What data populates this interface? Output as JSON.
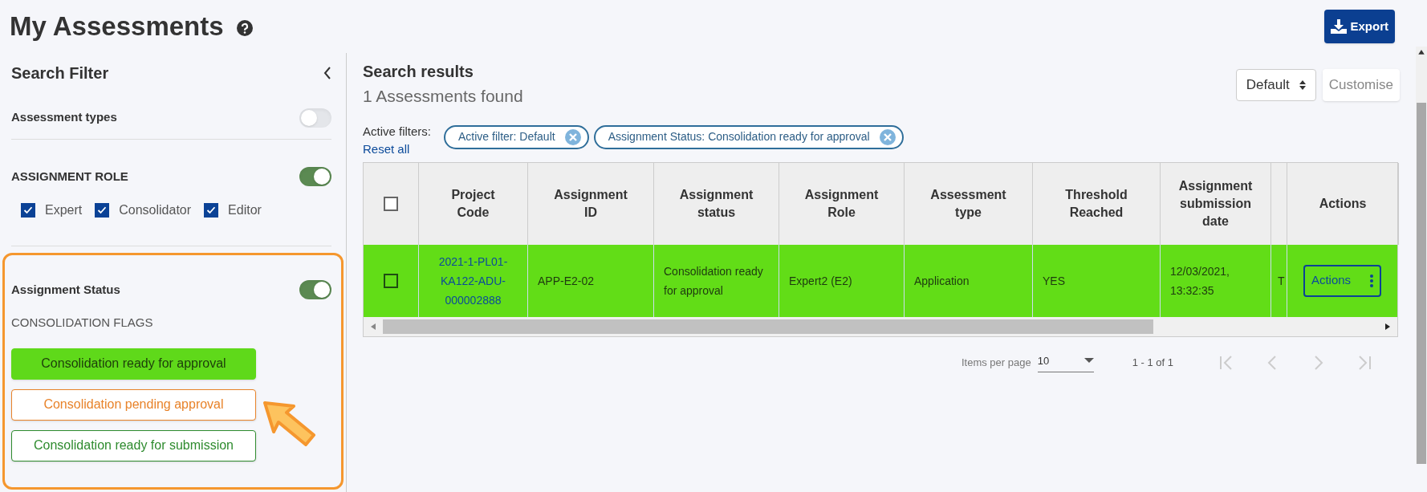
{
  "page": {
    "title": "My Assessments",
    "export_label": "Export"
  },
  "filter": {
    "title": "Search Filter",
    "assessment_types": {
      "label": "Assessment types",
      "on": false
    },
    "assignment_role": {
      "label": "ASSIGNMENT ROLE",
      "on": true,
      "options": [
        {
          "label": "Expert",
          "checked": true
        },
        {
          "label": "Consolidator",
          "checked": true
        },
        {
          "label": "Editor",
          "checked": true
        }
      ]
    },
    "assignment_status": {
      "label": "Assignment Status",
      "on": true,
      "subtitle": "CONSOLIDATION FLAGS",
      "flags": [
        {
          "label": "Consolidation ready for approval",
          "selected": true,
          "color": "#5fd91a"
        },
        {
          "label": "Consolidation pending approval",
          "selected": false,
          "color": "#e8832a"
        },
        {
          "label": "Consolidation ready for submission",
          "selected": false,
          "color": "#2e8b2e"
        }
      ]
    }
  },
  "results": {
    "title": "Search results",
    "count": "1 Assessments found",
    "view_select": "Default",
    "customise_label": "Customise",
    "active_filters_label": "Active filters:",
    "reset_label": "Reset all",
    "chips": [
      "Active filter: Default",
      "Assignment Status: Consolidation ready for approval"
    ],
    "table": {
      "columns": [
        "Project Code",
        "Assignment ID",
        "Assignment status",
        "Assignment Role",
        "Assessment type",
        "Threshold Reached",
        "Assignment submission date",
        "Actions"
      ],
      "header_checked": false,
      "rows": [
        {
          "checked": false,
          "color": "#62dd17",
          "cells": [
            "2021-1-PL01-KA122-ADU-000002888",
            "APP-E2-02",
            "Consolidation ready for approval",
            "Expert2 (E2)",
            "Application",
            "YES",
            "12/03/2021, 13:32:35",
            "T"
          ],
          "action_label": "Actions"
        }
      ]
    },
    "pagination": {
      "items_label": "Items per page",
      "page_size": "10",
      "range": "1 - 1 of 1"
    }
  }
}
